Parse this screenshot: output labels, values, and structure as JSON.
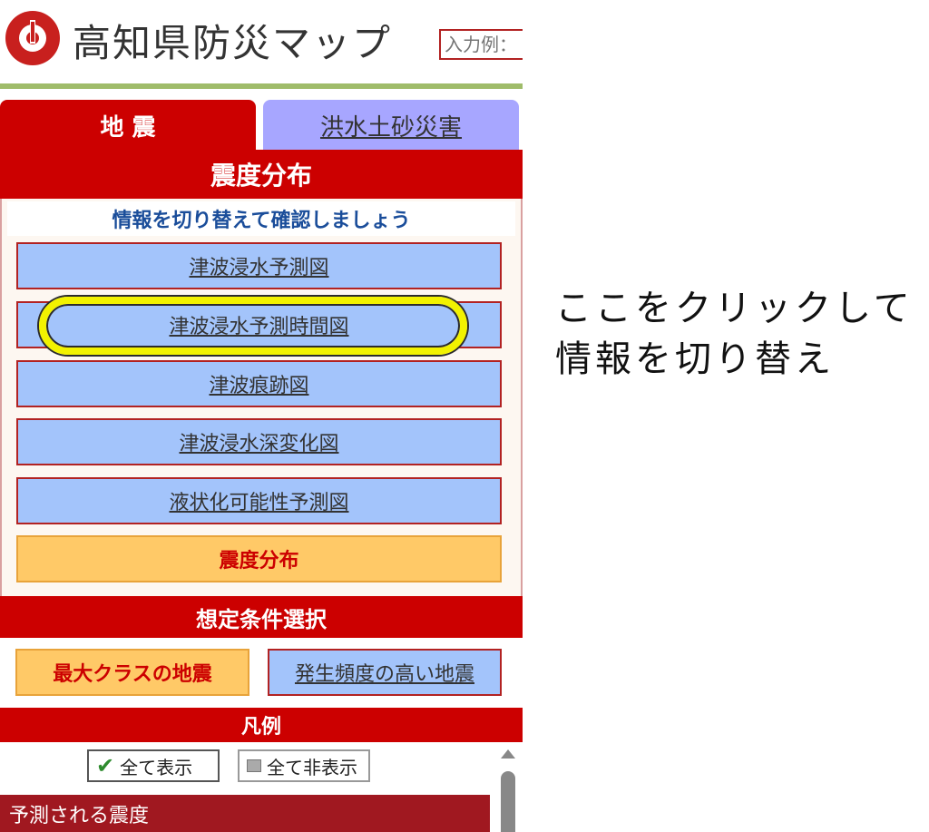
{
  "header": {
    "site_title": "高知県防災マップ",
    "search_placeholder": "入力例："
  },
  "tabs": [
    {
      "label": "地 震",
      "active": true
    },
    {
      "label": "洪水土砂災害",
      "active": false
    }
  ],
  "section_title": "震度分布",
  "instruction": "情報を切り替えて確認しましょう",
  "switch_buttons": [
    {
      "label": "津波浸水予測図",
      "active": false
    },
    {
      "label": "津波浸水予測時間図",
      "active": false
    },
    {
      "label": "津波痕跡図",
      "active": false
    },
    {
      "label": "津波浸水深変化図",
      "active": false
    },
    {
      "label": "液状化可能性予測図",
      "active": false
    },
    {
      "label": "震度分布",
      "active": true
    }
  ],
  "condition": {
    "title": "想定条件選択",
    "options": [
      {
        "label": "最大クラスの地震",
        "active": true
      },
      {
        "label": "発生頻度の高い地震",
        "active": false
      }
    ]
  },
  "legend": {
    "title": "凡例",
    "show_all": "全て表示",
    "hide_all": "全て非表示",
    "first_item": "予測される震度"
  },
  "annotation": {
    "line1": "ここをクリックして",
    "line2": "情報を切り替え"
  },
  "colors": {
    "brand_red": "#cc0000",
    "tab_blue": "#a7a6ff",
    "button_blue": "#a3c4fb",
    "active_orange": "#ffc967",
    "highlight_yellow": "#f2f200"
  }
}
